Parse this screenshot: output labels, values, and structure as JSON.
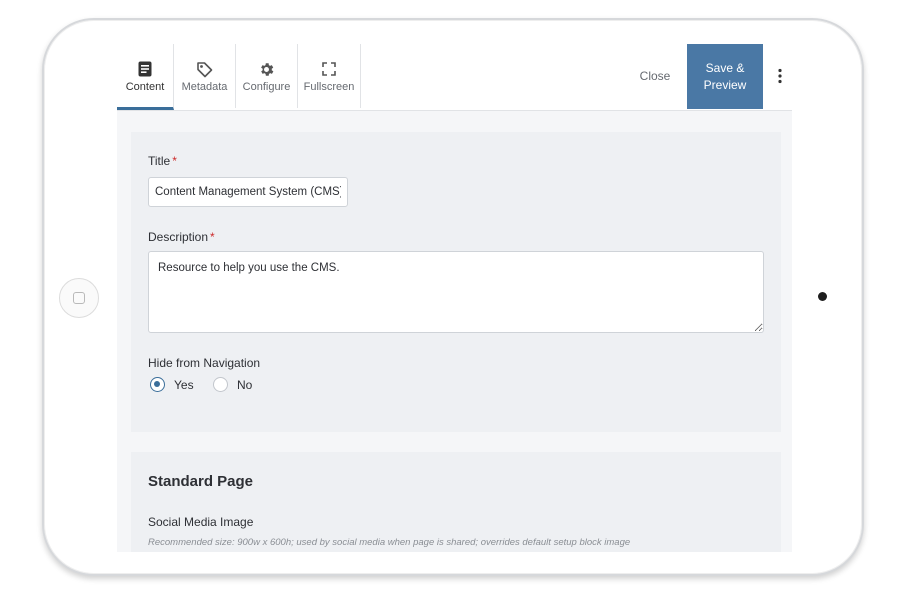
{
  "toolbar": {
    "tabs": [
      {
        "label": "Content",
        "icon": "document-icon"
      },
      {
        "label": "Metadata",
        "icon": "tag-icon"
      },
      {
        "label": "Configure",
        "icon": "gear-icon"
      },
      {
        "label": "Fullscreen",
        "icon": "fullscreen-icon"
      }
    ],
    "close_label": "Close",
    "save_label": "Save &\nPreview",
    "accent_color": "#4a78a5"
  },
  "form": {
    "title_label": "Title",
    "title_value": "Content Management System (CMS)",
    "required_mark": "*",
    "description_label": "Description",
    "description_value": "Resource to help you use the CMS.",
    "hide_nav_label": "Hide from Navigation",
    "hide_nav_options": [
      "Yes",
      "No"
    ],
    "hide_nav_selected": "Yes"
  },
  "standard_page": {
    "heading": "Standard Page",
    "social_image_label": "Social Media Image",
    "social_image_hint": "Recommended size: 900w x 600h; used by social media when page is shared; overrides default setup block image"
  }
}
